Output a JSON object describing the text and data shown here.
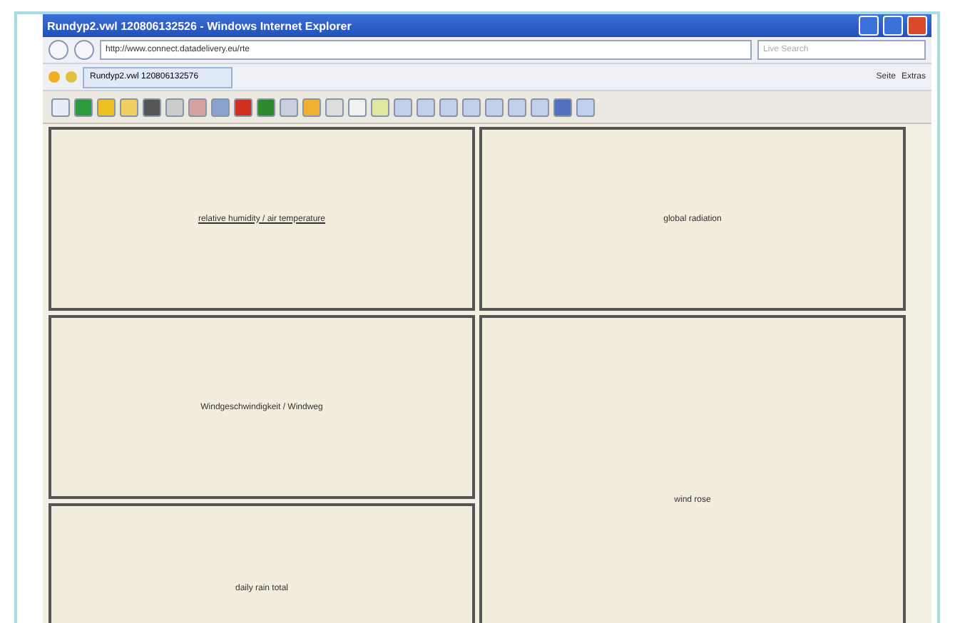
{
  "window": {
    "title": "Rundyp2.vwl 120806132526 - Windows Internet Explorer"
  },
  "address_bar": {
    "url": "http://www.connect.datadelivery.eu/rte",
    "search_placeholder": "Live Search"
  },
  "tab": {
    "label": "Rundyp2.vwl 120806132576"
  },
  "command_bar": {
    "items": [
      "Seite",
      "Extras"
    ]
  },
  "panels": {
    "left": [
      {
        "label": "relative humidity / air temperature",
        "link": true
      },
      {
        "label": "Windgeschwindigkeit / Windweg",
        "link": false
      },
      {
        "label": "daily rain total",
        "link": false
      }
    ],
    "right": [
      {
        "label": "global radiation",
        "link": false
      },
      {
        "label": "wind rose",
        "link": false
      }
    ]
  }
}
